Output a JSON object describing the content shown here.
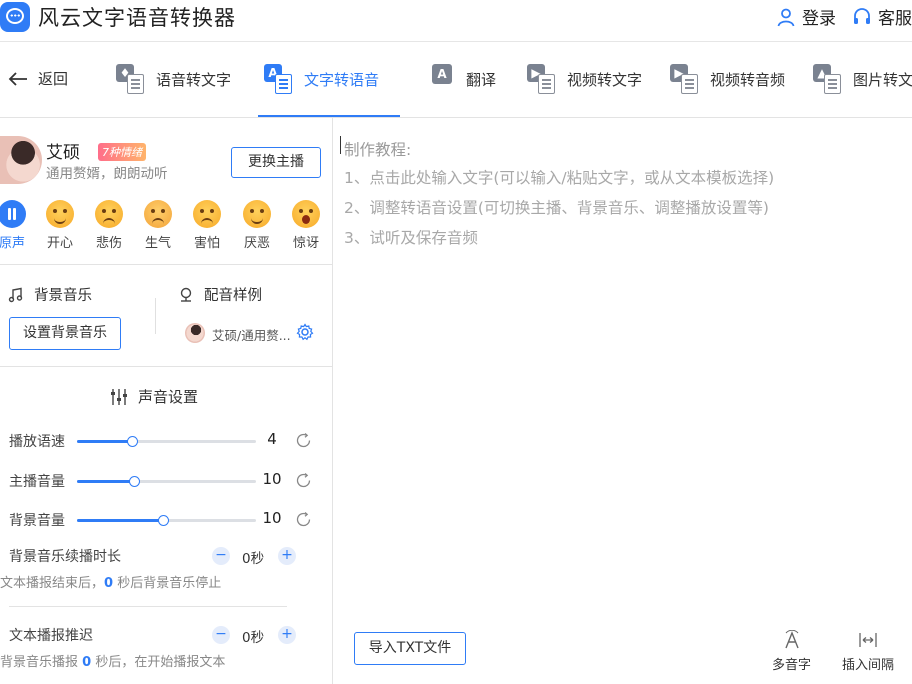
{
  "app": {
    "title": "风云文字语音转换器",
    "login": "登录",
    "service": "客服"
  },
  "nav": {
    "back": "返回",
    "tabs": [
      {
        "label": "语音转文字",
        "icon": "mic-doc-icon"
      },
      {
        "label": "文字转语音",
        "icon": "text-doc-icon",
        "active": true
      },
      {
        "label": "翻译",
        "icon": "translate-icon"
      },
      {
        "label": "视频转文字",
        "icon": "video-doc-icon"
      },
      {
        "label": "视频转音频",
        "icon": "video-audio-icon"
      },
      {
        "label": "图片转文字",
        "icon": "image-doc-icon"
      }
    ]
  },
  "anchor": {
    "name": "艾硕",
    "emotion_badge": "7种情绪",
    "description": "通用赘婿，朗朗动听",
    "change_button": "更换主播"
  },
  "emotions": [
    {
      "label": "原声",
      "active": true
    },
    {
      "label": "开心"
    },
    {
      "label": "悲伤"
    },
    {
      "label": "生气"
    },
    {
      "label": "害怕"
    },
    {
      "label": "厌恶"
    },
    {
      "label": "惊讶"
    }
  ],
  "bgm": {
    "label": "背景音乐",
    "button": "设置背景音乐"
  },
  "sample": {
    "label": "配音样例",
    "name": "艾硕/通用赘..."
  },
  "voice_settings": {
    "title": "声音设置",
    "sliders": [
      {
        "label": "播放语速",
        "value": "4",
        "fraction": 0.31
      },
      {
        "label": "主播音量",
        "value": "10",
        "fraction": 0.32
      },
      {
        "label": "背景音量",
        "value": "10",
        "fraction": 0.48
      }
    ],
    "bgm_extend": {
      "label": "背景音乐续播时长",
      "value": "0秒",
      "hint_prefix": "文本播报结束后，",
      "hint_num": "0",
      "hint_suffix": " 秒后背景音乐停止"
    },
    "text_delay": {
      "label": "文本播报推迟",
      "value": "0秒",
      "hint_prefix": "背景音乐播报 ",
      "hint_num": "0",
      "hint_suffix": " 秒后，在开始播报文本"
    }
  },
  "editor": {
    "tutorial_title": "制作教程:",
    "tutorial_lines": [
      "1、点击此处输入文字(可以输入/粘贴文字，或从文本模板选择)",
      "2、调整转语音设置(可切换主播、背景音乐、调整播放设置等)",
      "3、试听及保存音频"
    ],
    "import_button": "导入TXT文件",
    "tools": [
      "多音字",
      "插入间隔"
    ]
  },
  "colors": {
    "accent": "#2f7cf6"
  }
}
